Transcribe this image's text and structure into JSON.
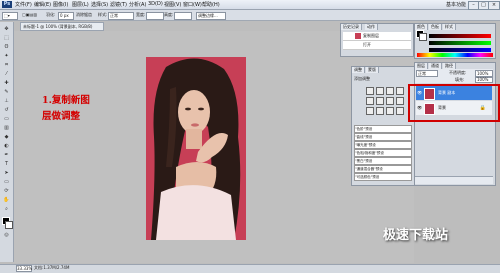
{
  "menubar": {
    "logo": "Ps",
    "items": [
      "文件(F)",
      "编辑(E)",
      "图像(I)",
      "图层(L)",
      "选择(S)",
      "滤镜(T)",
      "分析(A)",
      "3D(D)",
      "视图(V)",
      "窗口(W)",
      "帮助(H)"
    ],
    "workspace": "基本功能"
  },
  "options": {
    "feather_label": "羽化:",
    "feather_value": "0 px",
    "antialias": "消除锯齿",
    "style_label": "样式:",
    "style_value": "正常",
    "width_label": "宽度:",
    "height_label": "高度:",
    "refine_edge": "调整边缘..."
  },
  "document": {
    "tab_title": "未标题-1 @ 100% (背景副本, RGB/8)",
    "zoom": "33.33%",
    "doc_info": "文档:1.37M/2.74M"
  },
  "annotation": {
    "line1": "1.复制新图",
    "line2": "层做调整"
  },
  "history": {
    "tabs": [
      "历史记录",
      "动作"
    ],
    "rows": [
      "复制图层",
      "打开"
    ]
  },
  "color_panel": {
    "tabs": [
      "颜色",
      "色板",
      "样式"
    ]
  },
  "adjustments": {
    "tabs": [
      "调整",
      "蒙版"
    ],
    "title": "添加调整",
    "presets": [
      "\"色阶\"预设",
      "\"曲线\"预设",
      "\"曝光度\"预设",
      "\"色相/饱和度\"预设",
      "\"黑白\"预设",
      "\"通道混合器\"预设",
      "\"可选颜色\"预设"
    ]
  },
  "layers": {
    "tabs": [
      "图层",
      "通道",
      "路径"
    ],
    "blend_mode": "正常",
    "opacity_label": "不透明度:",
    "opacity": "100%",
    "fill_label": "填充:",
    "fill": "100%",
    "items": [
      {
        "name": "背景 副本",
        "selected": true
      },
      {
        "name": "背景",
        "selected": false
      }
    ]
  },
  "watermark": "极速下载站",
  "colors": {
    "accent": "#3b82e0",
    "highlight": "#d00000",
    "photo_bg": "#c73f56"
  }
}
